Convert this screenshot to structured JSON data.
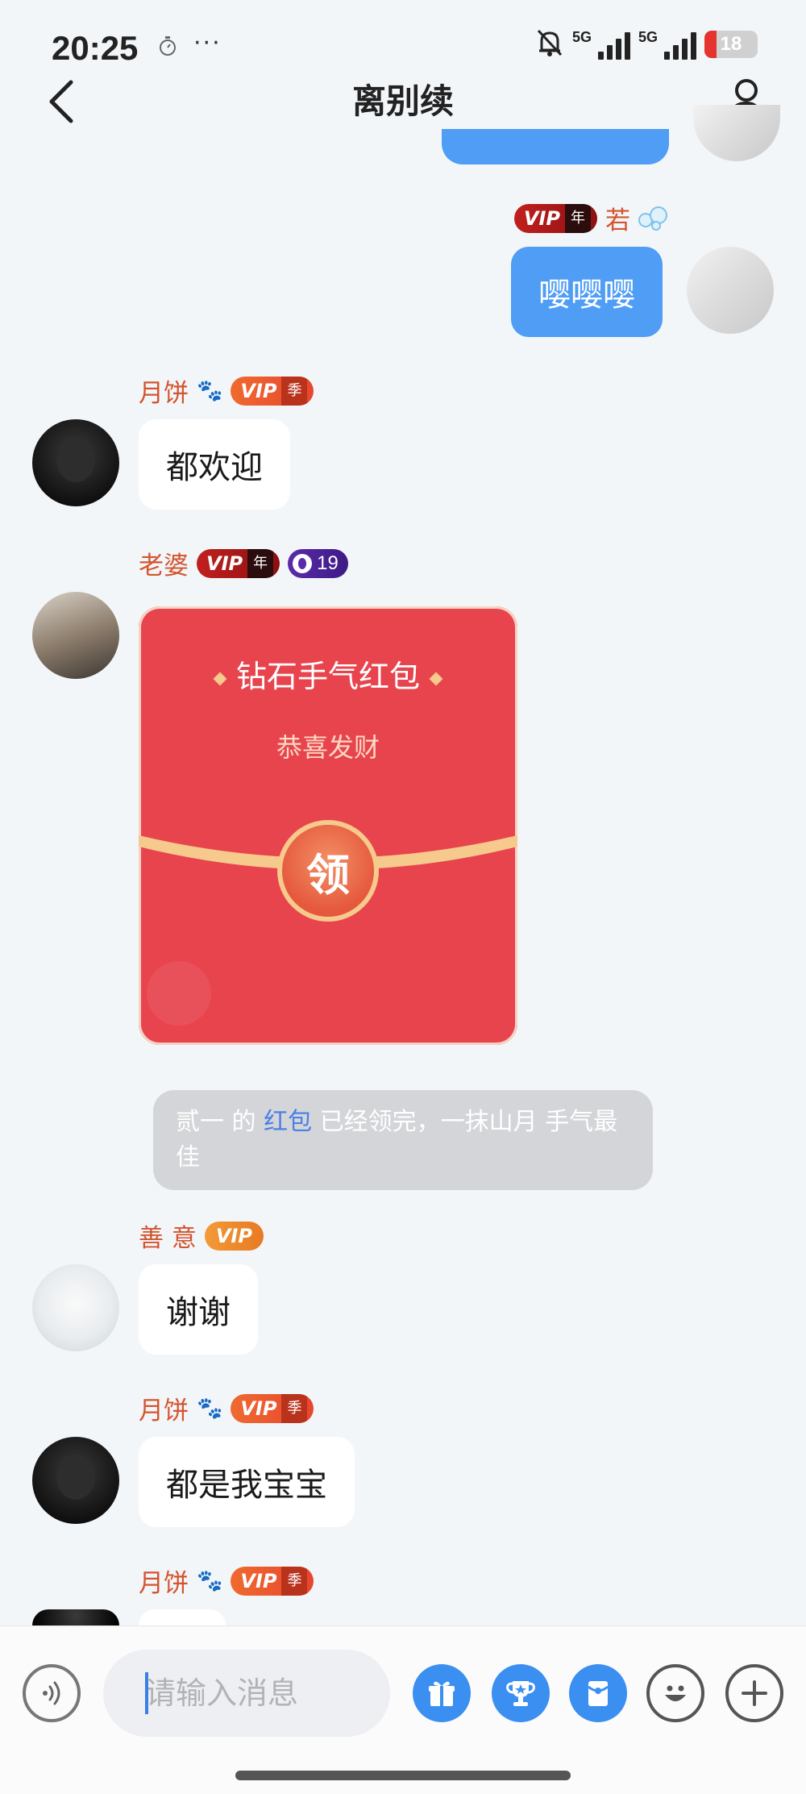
{
  "status_bar": {
    "time": "20:25",
    "icons": [
      "stopwatch-icon",
      "more-dots-icon",
      "bell-muted-icon",
      "signal-5g-icon",
      "signal-5g-icon",
      "battery-icon"
    ],
    "more": "···",
    "network_1": "5G",
    "network_2": "5G",
    "battery": "18"
  },
  "header": {
    "title": "离别续",
    "back_icon": "chevron-left-icon",
    "profile_icon": "group-profile-icon"
  },
  "messages": [
    {
      "sender": "若",
      "vip_badge": "VIP",
      "vip_tier": "年",
      "text": "嘤嘤嘤",
      "mine": true
    },
    {
      "sender": "月饼",
      "vip_badge": "VIP",
      "vip_tier": "季",
      "text": "都欢迎"
    },
    {
      "sender": "老婆",
      "vip_badge": "VIP",
      "vip_tier": "年",
      "level": "19",
      "red_packet": {
        "title": "钻石手气红包",
        "subtitle": "恭喜发财",
        "button": "领"
      }
    },
    {
      "sender": "善 意",
      "vip_badge": "VIP",
      "text": "谢谢"
    },
    {
      "sender": "月饼",
      "vip_badge": "VIP",
      "vip_tier": "季",
      "text": "都是我宝宝"
    },
    {
      "sender": "月饼",
      "vip_badge": "VIP",
      "vip_tier": "季"
    }
  ],
  "system_notice": {
    "part1": "贰一 的 ",
    "link": "红包",
    "part2": " 已经领完，一抹山月 手气最佳"
  },
  "input_bar": {
    "placeholder": "请输入消息",
    "buttons": [
      "voice-icon",
      "gift-icon",
      "trophy-icon",
      "red-packet-icon",
      "emoji-icon",
      "plus-icon"
    ]
  },
  "colors": {
    "bubble_mine": "#4f9df5",
    "red_packet": "#e8444e",
    "name_color": "#d4542e",
    "highlight_link": "#4a7fe6"
  }
}
